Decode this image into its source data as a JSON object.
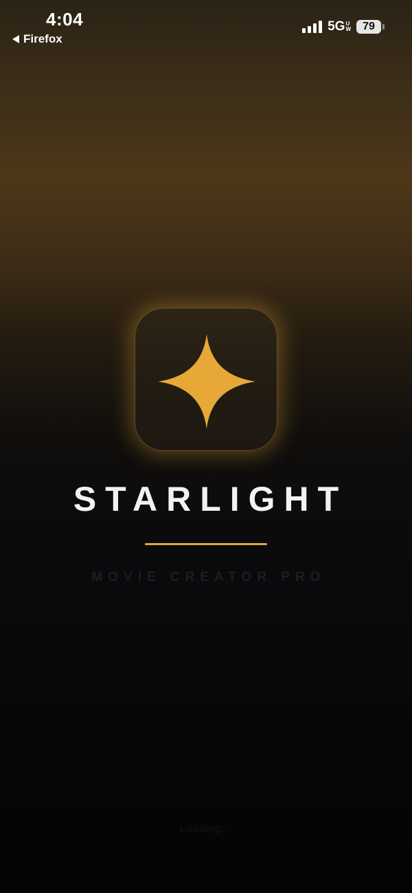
{
  "status_bar": {
    "time": "4:04",
    "back_app": "Firefox",
    "network": "5G",
    "network_sup_top": "U",
    "network_sup_bottom": "W",
    "battery": "79"
  },
  "app_icon": {
    "icon": "four-point-star-icon",
    "accent_color": "#E8A838"
  },
  "splash": {
    "title": "STARLIGHT",
    "subtitle": "MOVIE CREATOR PRO",
    "footer": "Loading..."
  },
  "colors": {
    "accent": "#E2A640",
    "background_top": "#4D3719",
    "background_bottom": "#040406"
  }
}
